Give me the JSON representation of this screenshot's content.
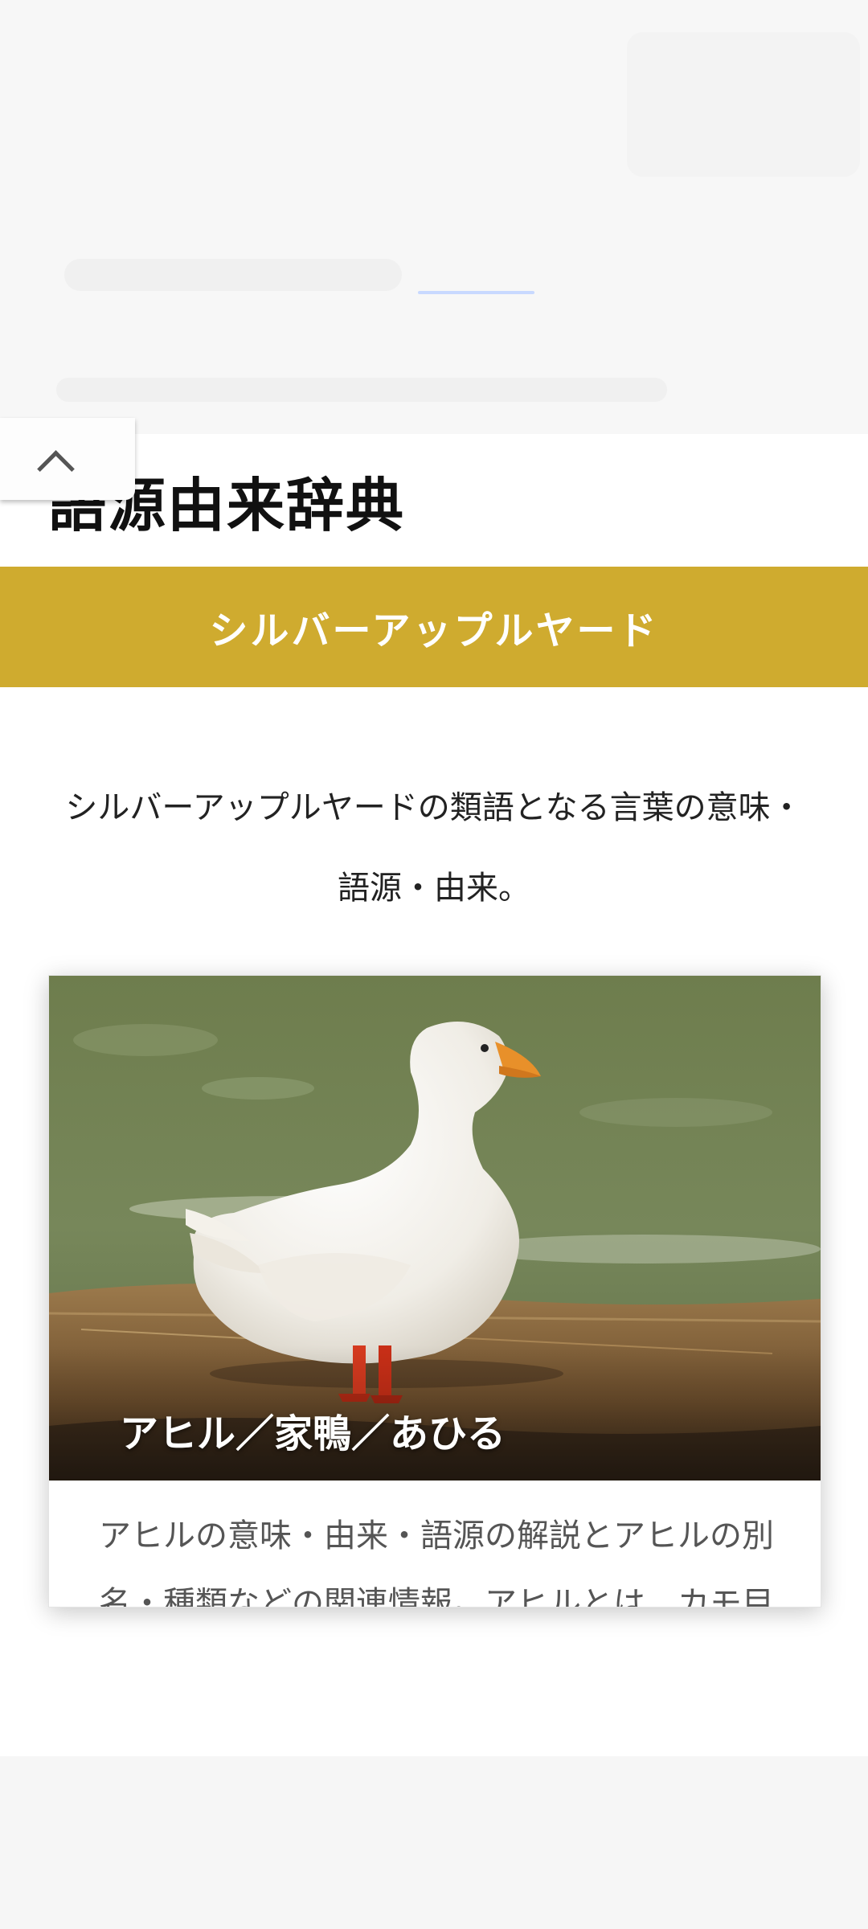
{
  "header": {
    "site_title": "語源由来辞典"
  },
  "heading_bar": {
    "title": "シルバーアップルヤード",
    "color": "#cfab2f"
  },
  "intro": {
    "text": "シルバーアップルヤードの類語となる言葉の意味・語源・由来。"
  },
  "cards": [
    {
      "image_caption": "アヒル／家鴨／あひる",
      "excerpt": "アヒルの意味・由来・語源の解説とアヒルの別名・種類などの関連情報。アヒルとは、カモ目カモ科の鳥。マガモを改良した…",
      "image_icon": "duck-photo"
    }
  ],
  "ui": {
    "collapse_icon": "chevron-up-icon"
  }
}
